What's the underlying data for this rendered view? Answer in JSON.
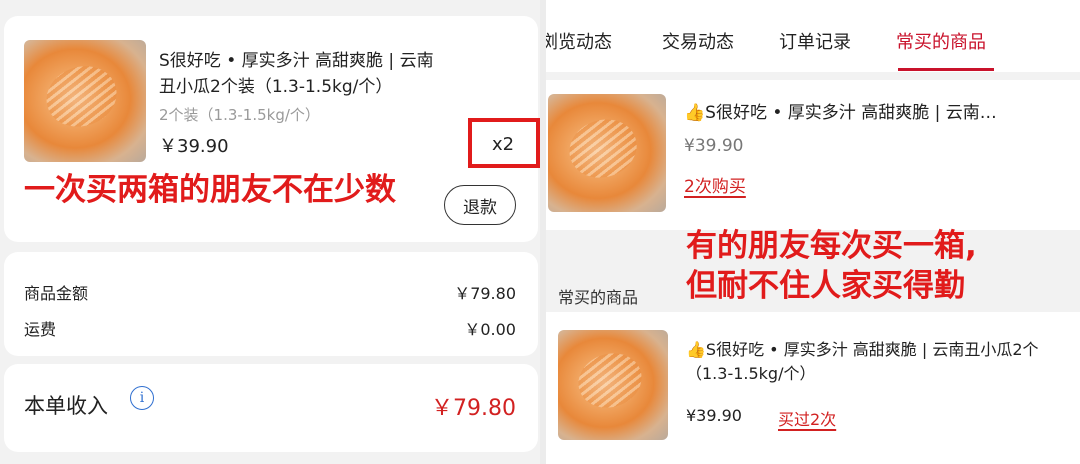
{
  "left": {
    "order": {
      "title_line1": "S很好吃 • 厚实多汁 高甜爽脆 | 云南",
      "title_line2": "丑小瓜2个装（1.3-1.5kg/个）",
      "spec": "2个装（1.3-1.5kg/个）",
      "price": "￥39.90",
      "quantity": "x2",
      "refund_button": "退款"
    },
    "annotation": "一次买两箱的朋友不在少数",
    "summary": {
      "goods_amount_label": "商品金额",
      "goods_amount_value": "￥79.80",
      "shipping_label": "运费",
      "shipping_value": "￥0.00"
    },
    "income": {
      "label": "本单收入",
      "info_icon": "i",
      "value": "￥79.80"
    }
  },
  "right": {
    "tabs": [
      {
        "label": "浏览动态"
      },
      {
        "label": "交易动态"
      },
      {
        "label": "订单记录"
      },
      {
        "label": "常买的商品"
      }
    ],
    "active_tab_color": "#c9122b",
    "item1": {
      "title": "👍S很好吃 • 厚实多汁 高甜爽脆 | 云南…",
      "price": "¥39.90",
      "badge": "2次购买"
    },
    "annotation_line1": "有的朋友每次买一箱,",
    "annotation_line2": "但耐不住人家买得勤",
    "section_title": "常买的商品",
    "item2": {
      "title_line1": "👍S很好吃 • 厚实多汁 高甜爽脆 | 云南丑小瓜2个",
      "title_line2": "（1.3-1.5kg/个）",
      "price": "¥39.90",
      "badge": "买过2次"
    }
  },
  "colors": {
    "annotation_red": "#e11b1b",
    "price_red": "#d22121",
    "brand_red": "#c9122b"
  }
}
